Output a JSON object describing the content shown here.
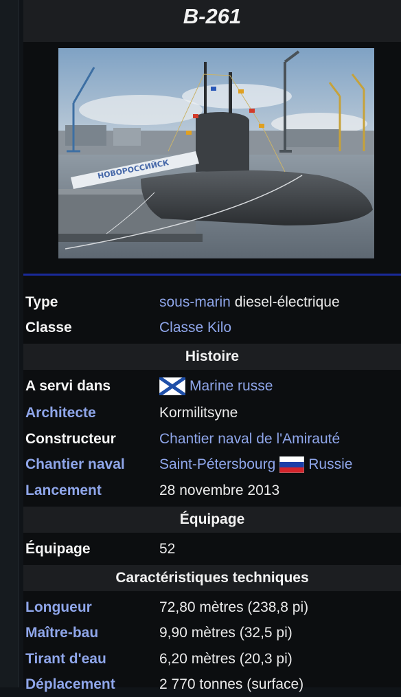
{
  "title": "B-261",
  "image": {
    "alt": "Sous-marin B-261 Novorossiisk à quai",
    "hull_lettering": "НОВОРОССИЙСК"
  },
  "fields": {
    "type": {
      "label": "Type",
      "value_link": "sous-marin",
      "value_text": "diesel-électrique"
    },
    "classe": {
      "label": "Classe",
      "value_link": "Classe Kilo"
    },
    "servi": {
      "label": "A servi dans",
      "flag": "naval-ensign-icon",
      "value_link": "Marine russe"
    },
    "architecte": {
      "label": "Architecte",
      "value_text": "Kormilitsyne"
    },
    "constructeur": {
      "label": "Constructeur",
      "value_link": "Chantier naval de l'Amirauté"
    },
    "chantier": {
      "label": "Chantier naval",
      "value_link": "Saint-Pétersbourg",
      "flag": "russia-flag-icon",
      "value_link2": "Russie"
    },
    "lancement": {
      "label": "Lancement",
      "value_text": "28 novembre 2013"
    },
    "equipage": {
      "label": "Équipage",
      "value_text": "52"
    },
    "longueur": {
      "label": "Longueur",
      "value_text": "72,80 mètres (238,8 pi)"
    },
    "maitrebau": {
      "label": "Maître-bau",
      "value_text": "9,90 mètres (32,5 pi)"
    },
    "tirant": {
      "label": "Tirant d'eau",
      "value_text": "6,20 mètres (20,3 pi)"
    },
    "deplacement": {
      "label": "Déplacement",
      "value_text": "2 770 tonnes (surface)"
    }
  },
  "sections": {
    "histoire": "Histoire",
    "equipage": "Équipage",
    "caracteristiques": "Caractéristiques techniques"
  },
  "colors": {
    "link": "#8fa6ea",
    "section_bg": "#1c1e21",
    "divider": "#1a2a9a",
    "page_bg": "#0c0e10"
  }
}
